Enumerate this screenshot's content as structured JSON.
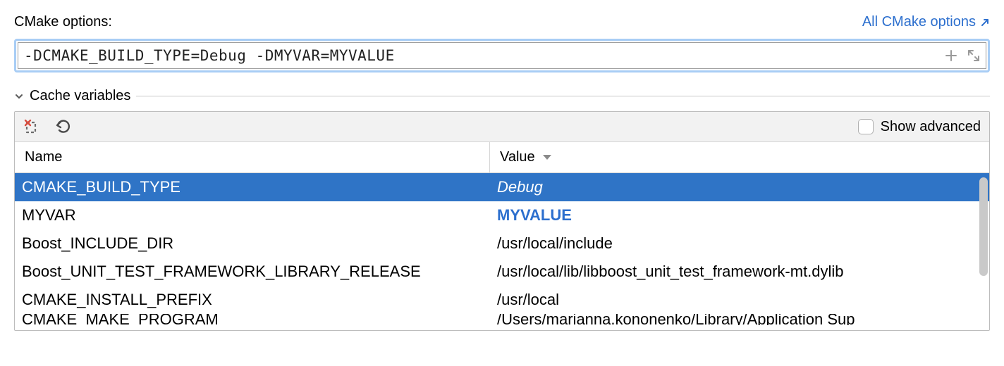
{
  "header": {
    "options_label": "CMake options:",
    "all_options_link": "All CMake options"
  },
  "cmake_input": {
    "value": "-DCMAKE_BUILD_TYPE=Debug -DMYVAR=MYVALUE"
  },
  "section": {
    "title": "Cache variables"
  },
  "toolbar": {
    "show_advanced_label": "Show advanced",
    "show_advanced_checked": false
  },
  "table": {
    "columns": {
      "name": "Name",
      "value": "Value"
    },
    "rows": [
      {
        "name": "CMAKE_BUILD_TYPE",
        "value": "Debug",
        "selected": true
      },
      {
        "name": "MYVAR",
        "value": "MYVALUE",
        "myvar": true
      },
      {
        "name": "Boost_INCLUDE_DIR",
        "value": "/usr/local/include"
      },
      {
        "name": "Boost_UNIT_TEST_FRAMEWORK_LIBRARY_RELEASE",
        "value": "/usr/local/lib/libboost_unit_test_framework-mt.dylib"
      },
      {
        "name": "CMAKE_INSTALL_PREFIX",
        "value": "/usr/local"
      },
      {
        "name": "CMAKE_MAKE_PROGRAM",
        "value": "/Users/marianna.kononenko/Library/Application Sup",
        "partial": true
      }
    ]
  }
}
